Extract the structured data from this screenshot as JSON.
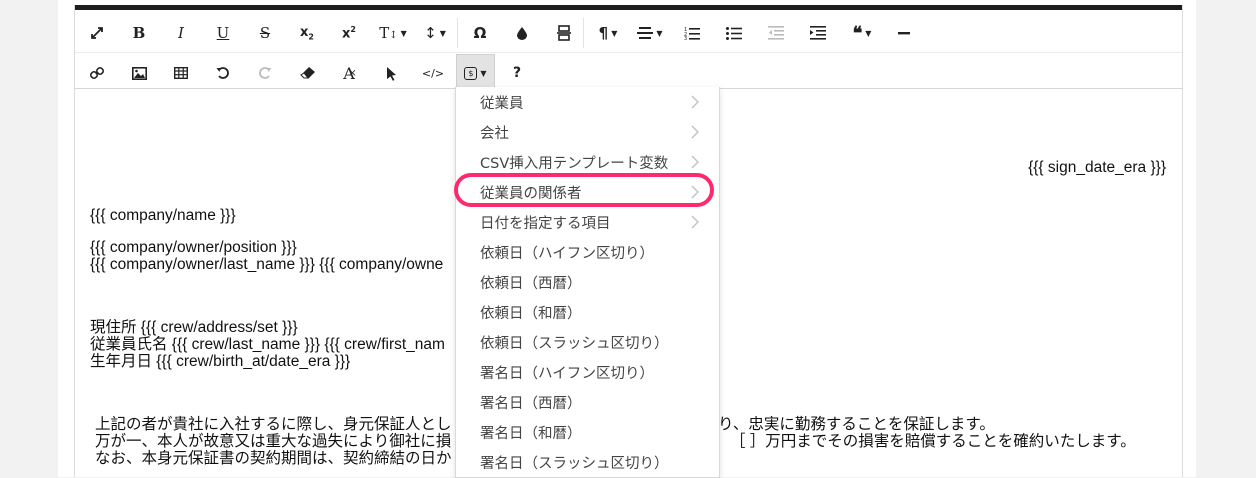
{
  "toolbar": {
    "row1": [
      {
        "name": "fullscreen-button",
        "icon": "expand-icon"
      },
      {
        "name": "bold-button",
        "icon": "bold-icon",
        "label": "B"
      },
      {
        "name": "italic-button",
        "icon": "italic-icon",
        "label": "I"
      },
      {
        "name": "underline-button",
        "icon": "underline-icon",
        "label": "U"
      },
      {
        "name": "strikethrough-button",
        "icon": "strikethrough-icon",
        "label": "S"
      },
      {
        "name": "subscript-button",
        "icon": "subscript-icon"
      },
      {
        "name": "superscript-button",
        "icon": "superscript-icon"
      },
      {
        "name": "font-size-button",
        "icon": "font-size-icon"
      },
      {
        "name": "line-height-button",
        "icon": "line-height-icon"
      },
      {
        "name": "special-char-button",
        "icon": "omega-icon",
        "label": "Ω"
      },
      {
        "name": "color-button",
        "icon": "droplet-icon"
      },
      {
        "name": "block-button",
        "icon": "block-icon"
      },
      {
        "name": "paragraph-button",
        "icon": "pilcrow-icon",
        "label": "¶"
      },
      {
        "name": "align-button",
        "icon": "align-icon"
      },
      {
        "name": "ordered-list-button",
        "icon": "ordered-list-icon"
      },
      {
        "name": "unordered-list-button",
        "icon": "unordered-list-icon"
      },
      {
        "name": "outdent-button",
        "icon": "outdent-icon"
      },
      {
        "name": "indent-button",
        "icon": "indent-icon"
      },
      {
        "name": "quote-button",
        "icon": "quote-icon"
      },
      {
        "name": "horizontal-rule-button",
        "icon": "minus-icon"
      }
    ],
    "row2": [
      {
        "name": "link-button",
        "icon": "link-icon"
      },
      {
        "name": "image-button",
        "icon": "image-icon"
      },
      {
        "name": "table-button",
        "icon": "table-icon"
      },
      {
        "name": "undo-button",
        "icon": "undo-icon"
      },
      {
        "name": "redo-button",
        "icon": "redo-icon"
      },
      {
        "name": "eraser-button",
        "icon": "eraser-icon"
      },
      {
        "name": "clear-format-button",
        "icon": "clear-format-icon"
      },
      {
        "name": "select-button",
        "icon": "cursor-icon"
      },
      {
        "name": "source-button",
        "icon": "code-icon",
        "label": "</>"
      },
      {
        "name": "variables-button",
        "icon": "variable-icon"
      },
      {
        "name": "help-button",
        "icon": "help-icon",
        "label": "?"
      }
    ]
  },
  "document": {
    "sign_date": "{{{ sign_date_era }}}",
    "company_name": "{{{ company/name }}}",
    "owner_position": "{{{ company/owner/position }}}",
    "owner_name": "{{{ company/owner/last_name }}} {{{ company/owne",
    "address": "現住所 {{{ crew/address/set }}}",
    "employee_name": "従業員氏名 {{{ crew/last_name }}} {{{ crew/first_nam",
    "birth_date": "生年月日 {{{ crew/birth_at/date_era }}}",
    "body_line1_a": "上記の者が貴社に入社するに際し、身元保証人とし",
    "body_line1_b": "り、忠実に勤務することを保証します。",
    "body_line2_a": "万が一、本人が故意又は重大な過失により御社に損",
    "body_line2_b": "［ ］万円までその損害を賠償することを確約いたします。",
    "body_line3_a": "なお、本身元保証書の契約期間は、契約締結の日か"
  },
  "dropdown": {
    "items": [
      {
        "label": "従業員",
        "submenu": true
      },
      {
        "label": "会社",
        "submenu": true
      },
      {
        "label": "CSV挿入用テンプレート変数",
        "submenu": true
      },
      {
        "label": "従業員の関係者",
        "submenu": true,
        "highlighted": true
      },
      {
        "label": "日付を指定する項目",
        "submenu": true
      },
      {
        "label": "依頼日（ハイフン区切り）",
        "submenu": false
      },
      {
        "label": "依頼日（西暦）",
        "submenu": false
      },
      {
        "label": "依頼日（和暦）",
        "submenu": false
      },
      {
        "label": "依頼日（スラッシュ区切り）",
        "submenu": false
      },
      {
        "label": "署名日（ハイフン区切り）",
        "submenu": false
      },
      {
        "label": "署名日（西暦）",
        "submenu": false
      },
      {
        "label": "署名日（和暦）",
        "submenu": false
      },
      {
        "label": "署名日（スラッシュ区切り）",
        "submenu": false
      }
    ]
  },
  "colors": {
    "highlight": "#ff2a6d",
    "topbar": "#1e1e1e",
    "menu_text": "#444444"
  }
}
